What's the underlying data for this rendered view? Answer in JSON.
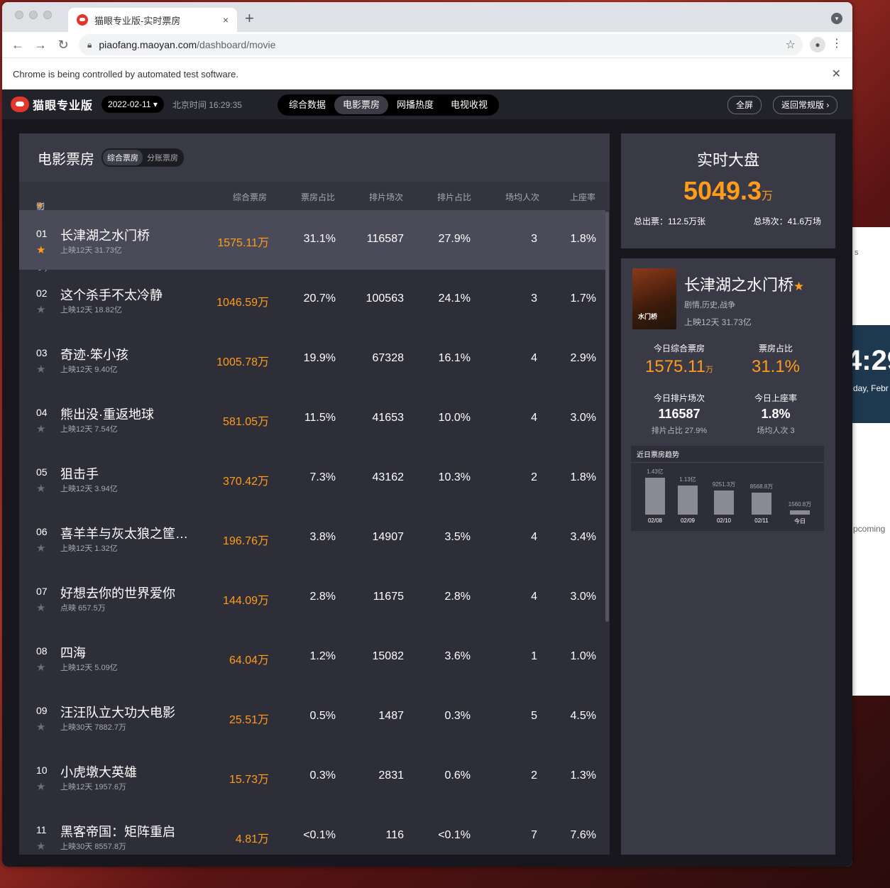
{
  "browser": {
    "tab_title": "猫眼专业版-实时票房",
    "tab_close": "×",
    "new_tab": "+",
    "url_host": "piaofang.maoyan.com",
    "url_path": "/dashboard/movie",
    "automation_notice": "Chrome is being controlled by automated test software."
  },
  "desktop": {
    "peek1": "s",
    "peek_time": "4:29",
    "peek_day": "day, Febr",
    "peek_upcoming": "pcoming"
  },
  "app": {
    "logo": "猫眼专业版",
    "date": "2022-02-11 ▾",
    "beijing_time": "北京时间 16:29:35",
    "nav": [
      "综合数据",
      "电影票房",
      "网播热度",
      "电视收视"
    ],
    "nav_active": 1,
    "fullscreen": "全屏",
    "back_normal": "返回常规版 ›"
  },
  "main": {
    "title": "电影票房",
    "seg": [
      "综合票房",
      "分账票房"
    ],
    "col_film": "影片 (点击",
    "col_film_tail": "切换右侧展示)",
    "col_star": "★",
    "cols": [
      "综合票房",
      "票房占比",
      "排片场次",
      "排片占比",
      "场均人次",
      "上座率"
    ]
  },
  "rows": [
    {
      "rank": "01",
      "name": "长津湖之水门桥",
      "sub": "上映12天  31.73亿",
      "bo": "1575.11万",
      "share": "31.1%",
      "shows": "116587",
      "showshare": "27.9%",
      "avg": "3",
      "seat": "1.8%",
      "starred": true
    },
    {
      "rank": "02",
      "name": "这个杀手不太冷静",
      "sub": "上映12天  18.82亿",
      "bo": "1046.59万",
      "share": "20.7%",
      "shows": "100563",
      "showshare": "24.1%",
      "avg": "3",
      "seat": "1.7%"
    },
    {
      "rank": "03",
      "name": "奇迹·笨小孩",
      "sub": "上映12天  9.40亿",
      "bo": "1005.78万",
      "share": "19.9%",
      "shows": "67328",
      "showshare": "16.1%",
      "avg": "4",
      "seat": "2.9%"
    },
    {
      "rank": "04",
      "name": "熊出没·重返地球",
      "sub": "上映12天  7.54亿",
      "bo": "581.05万",
      "share": "11.5%",
      "shows": "41653",
      "showshare": "10.0%",
      "avg": "4",
      "seat": "3.0%"
    },
    {
      "rank": "05",
      "name": "狙击手",
      "sub": "上映12天  3.94亿",
      "bo": "370.42万",
      "share": "7.3%",
      "shows": "43162",
      "showshare": "10.3%",
      "avg": "2",
      "seat": "1.8%"
    },
    {
      "rank": "06",
      "name": "喜羊羊与灰太狼之筐…",
      "sub": "上映12天  1.32亿",
      "bo": "196.76万",
      "share": "3.8%",
      "shows": "14907",
      "showshare": "3.5%",
      "avg": "4",
      "seat": "3.4%"
    },
    {
      "rank": "07",
      "name": "好想去你的世界爱你",
      "sub": "点映  657.5万",
      "bo": "144.09万",
      "share": "2.8%",
      "shows": "11675",
      "showshare": "2.8%",
      "avg": "4",
      "seat": "3.0%"
    },
    {
      "rank": "08",
      "name": "四海",
      "sub": "上映12天  5.09亿",
      "bo": "64.04万",
      "share": "1.2%",
      "shows": "15082",
      "showshare": "3.6%",
      "avg": "1",
      "seat": "1.0%"
    },
    {
      "rank": "09",
      "name": "汪汪队立大功大电影",
      "sub": "上映30天  7882.7万",
      "bo": "25.51万",
      "share": "0.5%",
      "shows": "1487",
      "showshare": "0.3%",
      "avg": "5",
      "seat": "4.5%"
    },
    {
      "rank": "10",
      "name": "小虎墩大英雄",
      "sub": "上映12天  1957.6万",
      "bo": "15.73万",
      "share": "0.3%",
      "shows": "2831",
      "showshare": "0.6%",
      "avg": "2",
      "seat": "1.3%"
    },
    {
      "rank": "11",
      "name": "黑客帝国：矩阵重启",
      "sub": "上映30天  8557.8万",
      "bo": "4.81万",
      "share": "<0.1%",
      "shows": "116",
      "showshare": "<0.1%",
      "avg": "7",
      "seat": "7.6%"
    }
  ],
  "market": {
    "title": "实时大盘",
    "value": "5049.3",
    "unit": "万",
    "tickets": "总出票：112.5万张",
    "shows": "总场次：41.6万场"
  },
  "detail": {
    "poster_text": "水门桥",
    "name": "长津湖之水门桥",
    "star": "★",
    "genre": "剧情,历史,战争",
    "release": "上映12天  31.73亿",
    "today_bo_label": "今日综合票房",
    "today_bo": "1575.11",
    "today_bo_unit": "万",
    "share_label": "票房占比",
    "share": "31.1%",
    "shows_label": "今日排片场次",
    "shows": "116587",
    "shows_foot": "排片占比 27.9%",
    "seat_label": "今日上座率",
    "seat": "1.8%",
    "seat_foot": "场均人次 3",
    "trend_title": "近日票房趋势"
  },
  "chart_data": {
    "type": "bar",
    "categories": [
      "02/08",
      "02/09",
      "02/10",
      "02/11",
      "今日"
    ],
    "labels": [
      "1.43亿",
      "1.13亿",
      "9251.3万",
      "8568.8万",
      "1560.8万"
    ],
    "values": [
      14300,
      11300,
      9251.3,
      8568.8,
      1560.8
    ],
    "title": "近日票房趋势"
  }
}
